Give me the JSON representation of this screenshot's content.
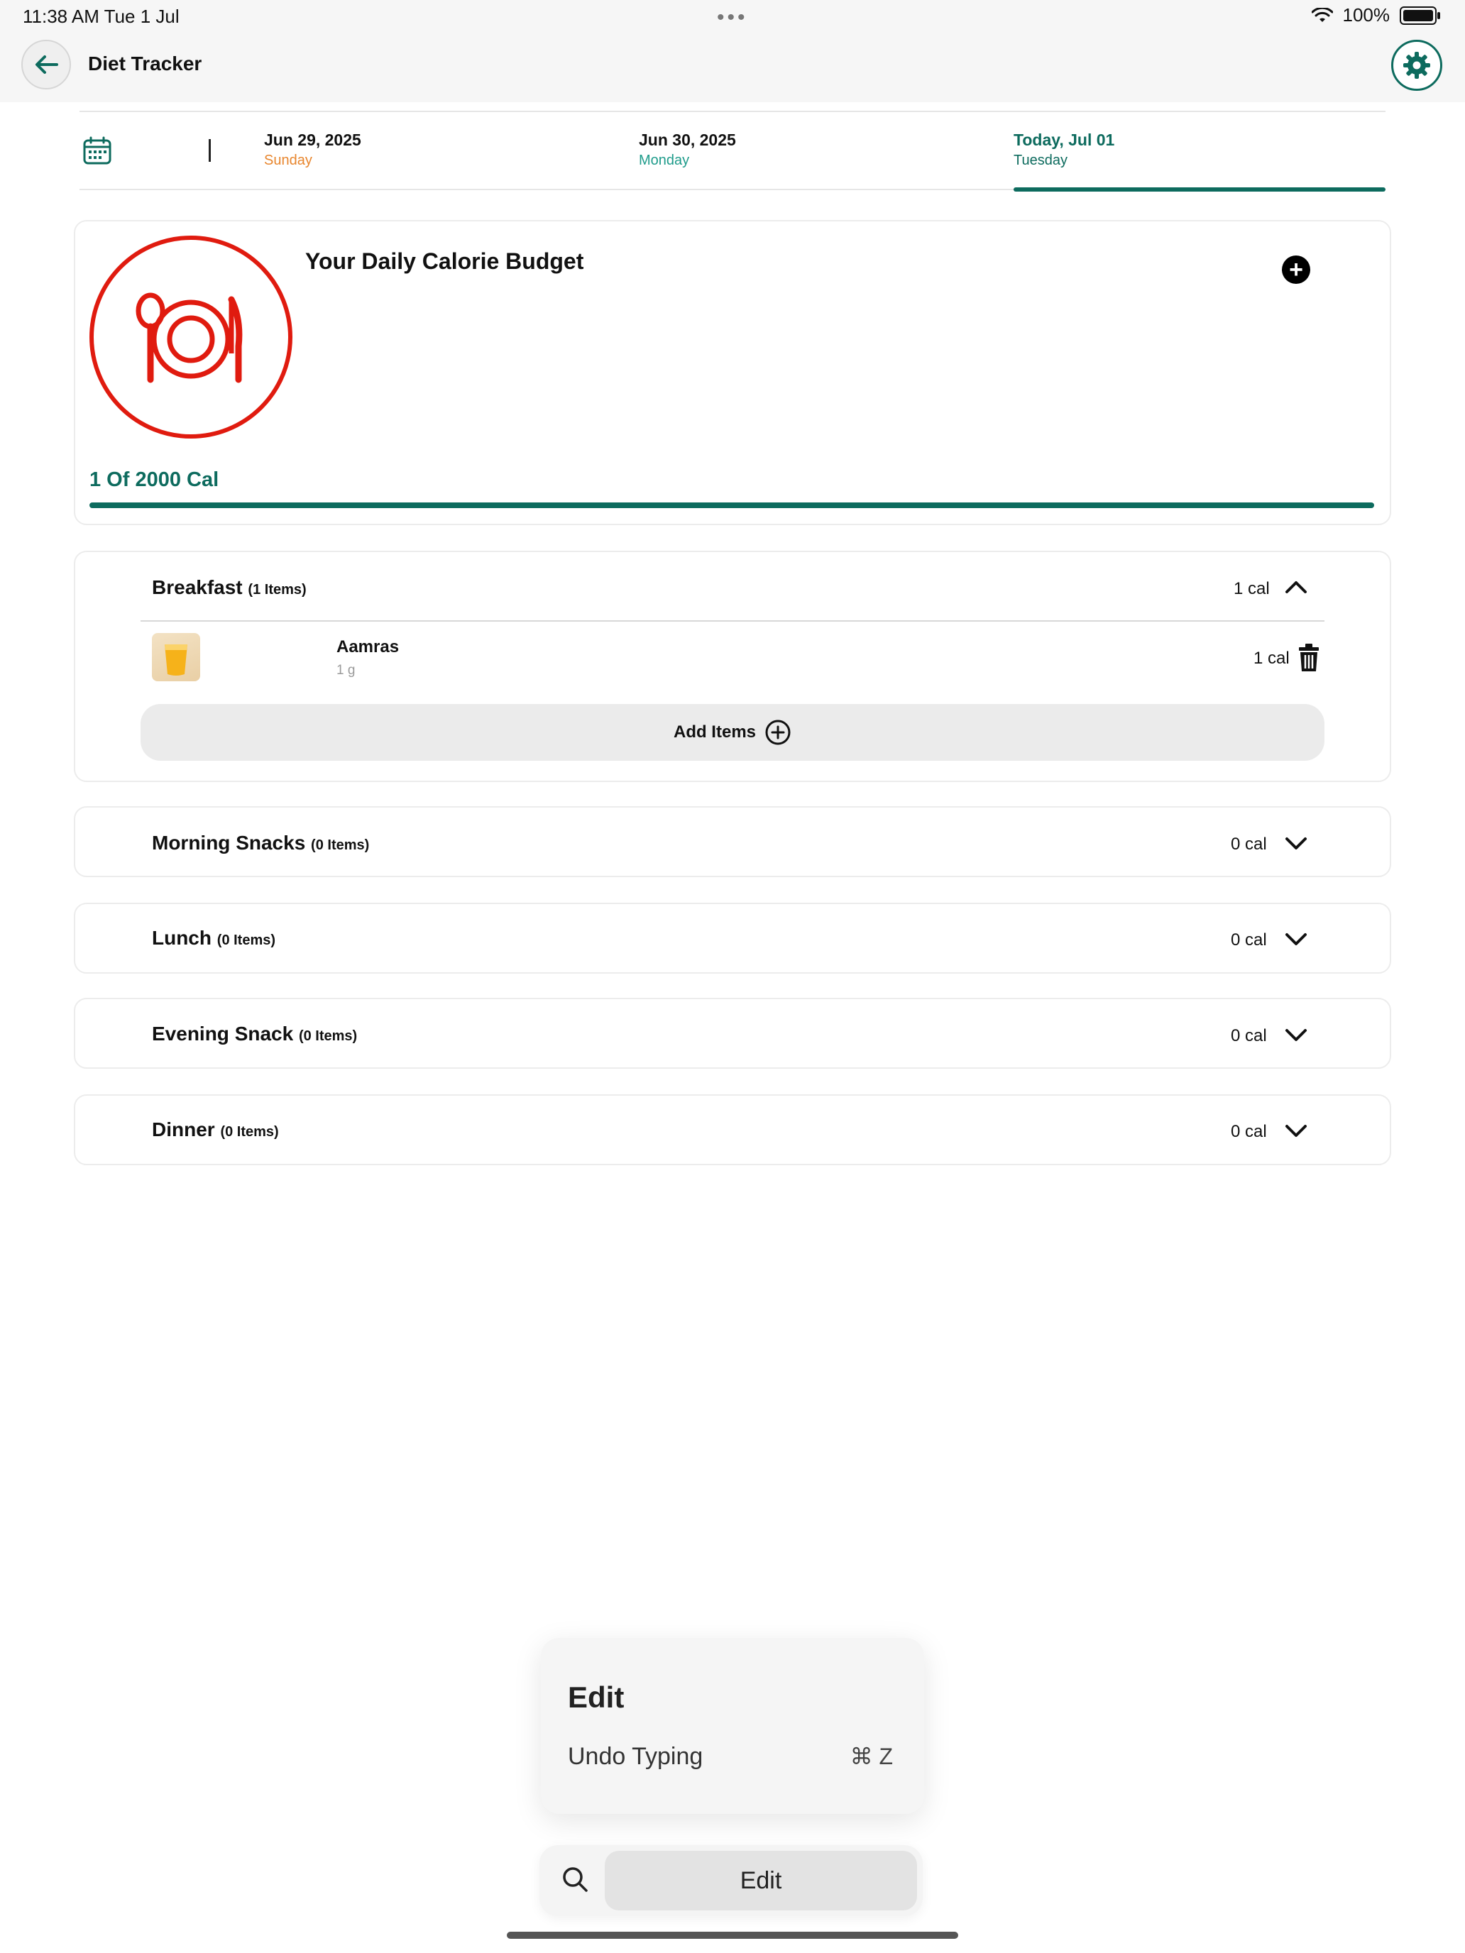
{
  "status_bar": {
    "time": "11:38 AM   Tue 1 Jul",
    "dots": "•••",
    "battery": "100%"
  },
  "header": {
    "title": "Diet Tracker",
    "back_icon": "arrow-left-icon",
    "settings_icon": "gear-icon"
  },
  "date_bar": {
    "dates": [
      {
        "main": "Jun 29, 2025",
        "sub": "Sunday",
        "sub_color": "#e8862e"
      },
      {
        "main": "Jun 30, 2025",
        "sub": "Monday",
        "sub_color": "#1f9c8b"
      },
      {
        "main": "Today, Jul 01",
        "sub": "Tuesday",
        "sub_color": "#0d6b5e"
      }
    ],
    "selected_index": 2
  },
  "budget": {
    "title": "Your Daily Calorie Budget",
    "calories_text": "1 Of 2000 Cal",
    "progress_fraction": 1.0,
    "accent": "#e01b0f"
  },
  "meals": {
    "breakfast": {
      "name": "Breakfast",
      "count": "(1 Items)",
      "cal": "1 cal",
      "items": [
        {
          "name": "Aamras",
          "qty": "1 g",
          "cal": "1 cal"
        }
      ],
      "add_label": "Add Items"
    },
    "morning_snacks": {
      "name": "Morning Snacks",
      "count": "(0 Items)",
      "cal": "0 cal"
    },
    "lunch": {
      "name": "Lunch",
      "count": "(0 Items)",
      "cal": "0 cal"
    },
    "evening_snack": {
      "name": "Evening Snack",
      "count": "(0 Items)",
      "cal": "0 cal"
    },
    "dinner": {
      "name": "Dinner",
      "count": "(0 Items)",
      "cal": "0 cal"
    }
  },
  "edit_menu": {
    "title": "Edit",
    "undo_label": "Undo Typing",
    "undo_shortcut": "⌘ Z"
  },
  "edit_bar": {
    "button_label": "Edit"
  },
  "colors": {
    "primary": "#0d6b5e",
    "danger": "#e01b0f"
  }
}
